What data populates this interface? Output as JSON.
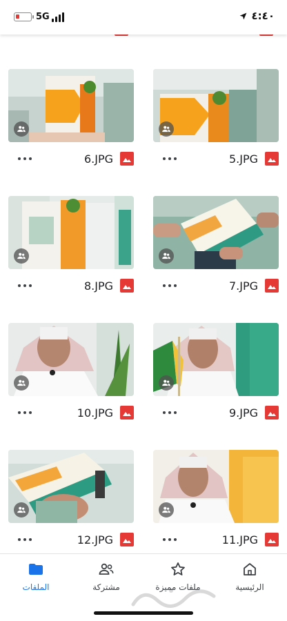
{
  "status_bar": {
    "network": "5G",
    "time": "٤:٤٠",
    "battery_color": "#e53935"
  },
  "files": [
    {
      "name": "6.JPG"
    },
    {
      "name": "5.JPG"
    },
    {
      "name": "8.JPG"
    },
    {
      "name": "7.JPG"
    },
    {
      "name": "10.JPG"
    },
    {
      "name": "9.JPG"
    },
    {
      "name": "12.JPG"
    },
    {
      "name": "11.JPG"
    }
  ],
  "bottom_nav": {
    "home": "الرئيسية",
    "starred": "ملفات مميزة",
    "shared": "مشتركة",
    "files": "الملفات"
  },
  "colors": {
    "accent": "#1a73e8",
    "image_file_icon": "#e53935"
  },
  "icons": {
    "shared_badge": "people-icon",
    "file_type": "image-icon",
    "more": "more-horizontal-icon"
  }
}
